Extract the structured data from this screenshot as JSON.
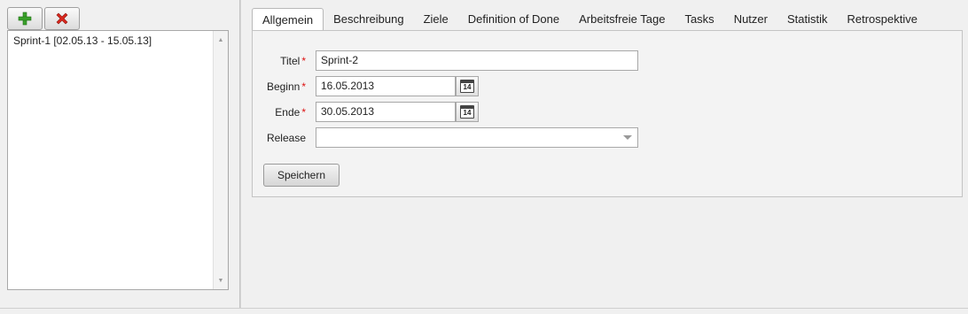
{
  "toolbar": {
    "add_icon": "plus-icon",
    "delete_icon": "delete-x-icon",
    "add_color": "#3aa12b",
    "delete_color": "#d9261c"
  },
  "sprint_list": {
    "items": [
      {
        "label": "Sprint-1 [02.05.13 - 15.05.13]"
      }
    ]
  },
  "tabs": [
    {
      "label": "Allgemein",
      "active": true
    },
    {
      "label": "Beschreibung"
    },
    {
      "label": "Ziele"
    },
    {
      "label": "Definition of Done"
    },
    {
      "label": "Arbeitsfreie Tage"
    },
    {
      "label": "Tasks"
    },
    {
      "label": "Nutzer"
    },
    {
      "label": "Statistik"
    },
    {
      "label": "Retrospektive"
    }
  ],
  "form": {
    "title": {
      "label": "Titel",
      "required_mark": "*",
      "value": "Sprint-2"
    },
    "begin": {
      "label": "Beginn",
      "required_mark": "*",
      "value": "16.05.2013",
      "calendar_day": "14"
    },
    "end": {
      "label": "Ende",
      "required_mark": "*",
      "value": "30.05.2013",
      "calendar_day": "14"
    },
    "release": {
      "label": "Release",
      "value": ""
    },
    "save_label": "Speichern",
    "required_color": "#dd1111"
  }
}
